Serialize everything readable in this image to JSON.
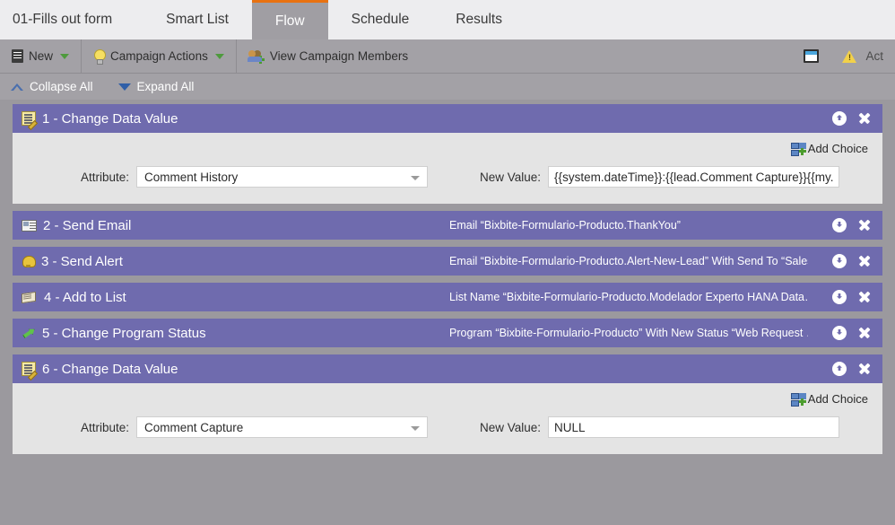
{
  "tabs": [
    {
      "label": "01-Fills out form",
      "active": false
    },
    {
      "label": "Smart List",
      "active": false
    },
    {
      "label": "Flow",
      "active": true
    },
    {
      "label": "Schedule",
      "active": false
    },
    {
      "label": "Results",
      "active": false
    }
  ],
  "toolbar": {
    "new_label": "New",
    "campaign_actions_label": "Campaign Actions",
    "view_members_label": "View Campaign Members",
    "warning_label": "Act"
  },
  "controlbar": {
    "collapse_all": "Collapse All",
    "expand_all": "Expand All"
  },
  "colors": {
    "step_header": "#6f6bae",
    "page_background": "#9b999e",
    "active_tab_accent": "#e87211",
    "panel_background": "#e4e4e4"
  },
  "steps": [
    {
      "number": "1",
      "title": "1 - Change Data Value",
      "icon": "change-data-value-icon",
      "description": "",
      "expanded": true,
      "toggle_icon": "circle-up-arrow-icon",
      "add_choice_label": "Add Choice",
      "attribute_label": "Attribute:",
      "attribute_value": "Comment History",
      "new_value_label": "New Value:",
      "new_value": "{{system.dateTime}}:{{lead.Comment Capture}}{{my."
    },
    {
      "number": "2",
      "title": "2 - Send Email",
      "icon": "email-icon",
      "description": "Email “Bixbite-Formulario-Producto.ThankYou”",
      "expanded": false,
      "toggle_icon": "circle-down-arrow-icon"
    },
    {
      "number": "3",
      "title": "3 - Send Alert",
      "icon": "bell-icon",
      "description": "Email “Bixbite-Formulario-Producto.Alert-New-Lead” With Send To “Sales…",
      "expanded": false,
      "toggle_icon": "circle-down-arrow-icon"
    },
    {
      "number": "4",
      "title": "4 - Add to List",
      "icon": "add-to-list-icon",
      "description": "List Name “Bixbite-Formulario-Producto.Modelador Experto HANA Data…",
      "expanded": false,
      "toggle_icon": "circle-down-arrow-icon"
    },
    {
      "number": "5",
      "title": "5 - Change Program Status",
      "icon": "program-status-icon",
      "description": "Program “Bixbite-Formulario-Producto” With New Status “Web Request …",
      "expanded": false,
      "toggle_icon": "circle-down-arrow-icon"
    },
    {
      "number": "6",
      "title": "6 - Change Data Value",
      "icon": "change-data-value-icon",
      "description": "",
      "expanded": true,
      "toggle_icon": "circle-up-arrow-icon",
      "add_choice_label": "Add Choice",
      "attribute_label": "Attribute:",
      "attribute_value": "Comment Capture",
      "new_value_label": "New Value:",
      "new_value": "NULL"
    }
  ]
}
